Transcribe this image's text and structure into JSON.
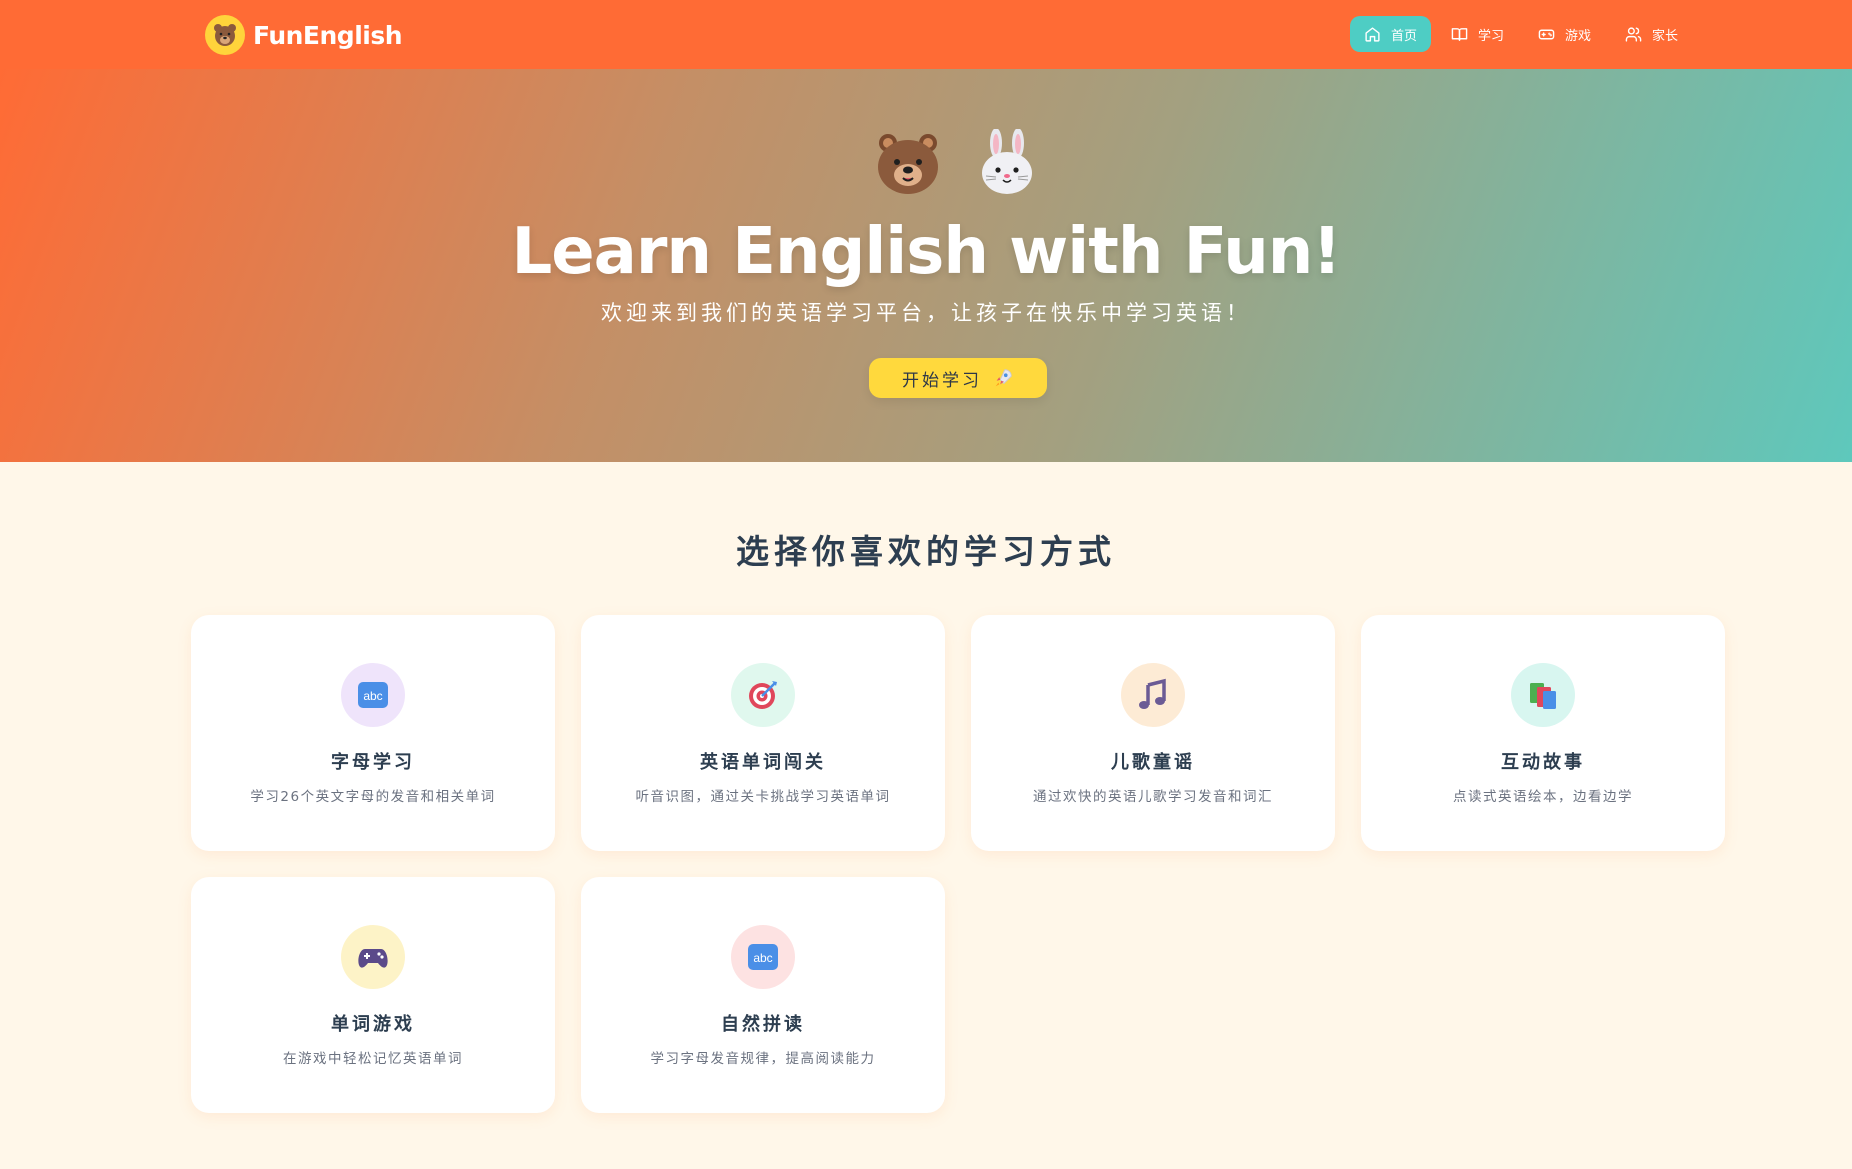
{
  "app": {
    "logo_text": "FunEnglish",
    "logo_icon": "bear-face-icon"
  },
  "nav": {
    "items": [
      {
        "label": "首页",
        "icon": "home-icon",
        "active": true
      },
      {
        "label": "学习",
        "icon": "book-icon",
        "active": false
      },
      {
        "label": "游戏",
        "icon": "gamepad-icon",
        "active": false
      },
      {
        "label": "家长",
        "icon": "users-icon",
        "active": false
      }
    ]
  },
  "hero": {
    "emojis": [
      "bear-face-icon",
      "rabbit-face-icon"
    ],
    "title": "Learn English with Fun!",
    "subtitle": "欢迎来到我们的英语学习平台，让孩子在快乐中学习英语！",
    "cta_label": "开始学习",
    "cta_icon": "rocket-icon"
  },
  "section": {
    "title": "选择你喜欢的学习方式"
  },
  "cards": [
    {
      "title": "字母学习",
      "desc": "学习26个英文字母的发音和相关单词",
      "icon": "abc-icon",
      "icon_bg": "#efe4fb"
    },
    {
      "title": "英语单词闯关",
      "desc": "听音识图，通过关卡挑战学习英语单词",
      "icon": "target-icon",
      "icon_bg": "#e0f8ee"
    },
    {
      "title": "儿歌童谣",
      "desc": "通过欢快的英语儿歌学习发音和词汇",
      "icon": "music-note-icon",
      "icon_bg": "#fdebd5"
    },
    {
      "title": "互动故事",
      "desc": "点读式英语绘本，边看边学",
      "icon": "books-icon",
      "icon_bg": "#d8f6f0"
    },
    {
      "title": "单词游戏",
      "desc": "在游戏中轻松记忆英语单词",
      "icon": "game-controller-icon",
      "icon_bg": "#fdf3c7"
    },
    {
      "title": "自然拼读",
      "desc": "学习字母发音规律，提高阅读能力",
      "icon": "abc-icon",
      "icon_bg": "#fde2e2"
    }
  ],
  "colors": {
    "navbar": "#ff6b35",
    "active_nav": "#4ecdc4",
    "cta": "#ffd93d",
    "page_bg": "#fff7e9",
    "title_text": "#2d3e50"
  }
}
